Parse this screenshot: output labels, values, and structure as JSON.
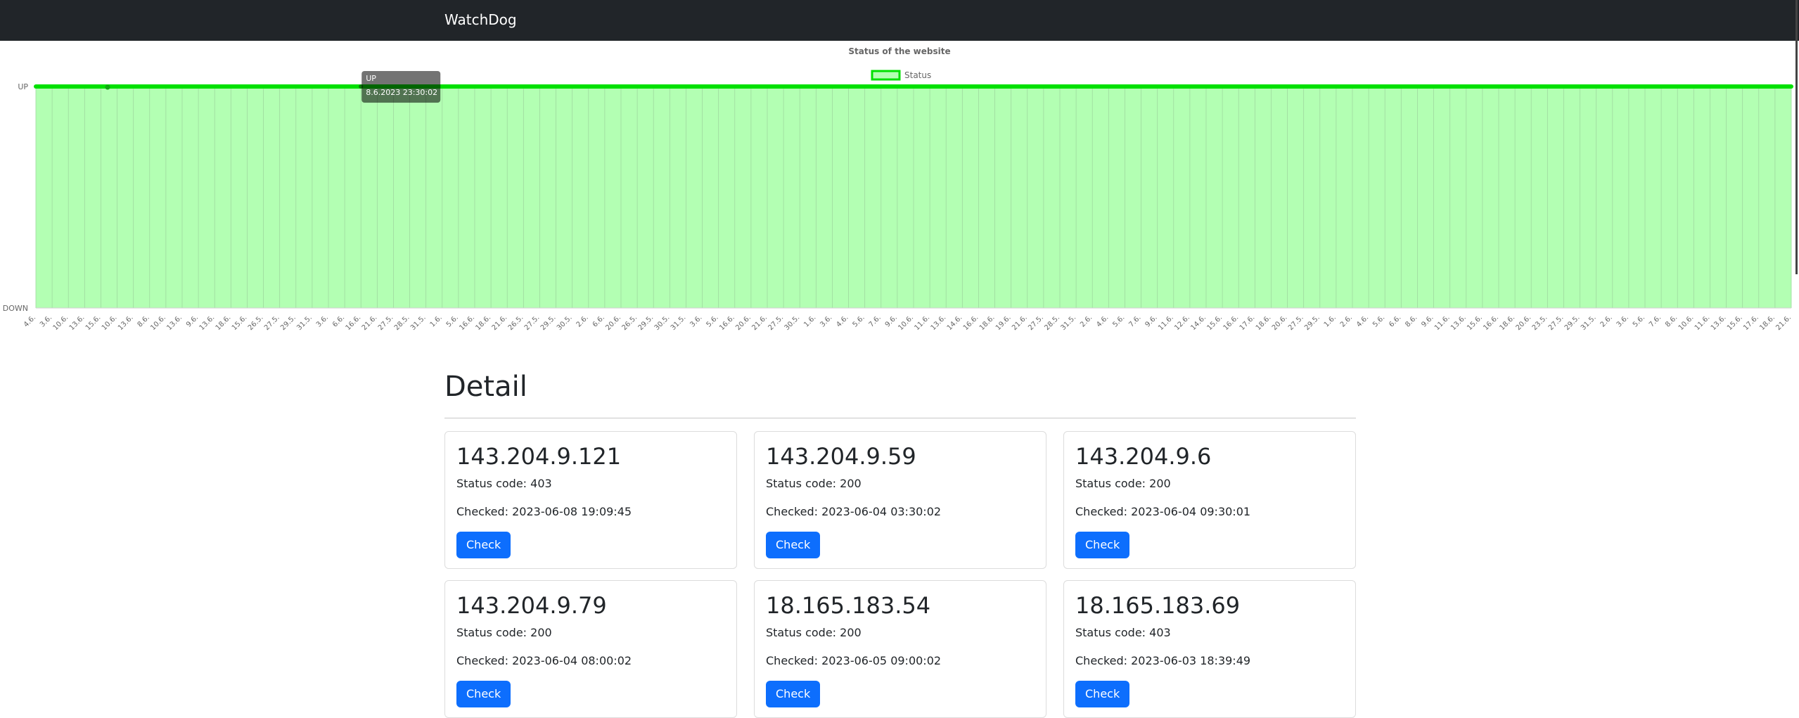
{
  "navbar": {
    "brand": "WatchDog"
  },
  "chart_data": {
    "type": "area",
    "title": "Status of the website",
    "legend": {
      "label": "Status",
      "position": "top-center"
    },
    "y_categories": [
      "DOWN",
      "UP"
    ],
    "x": [
      "4.6.",
      "3.6.",
      "10.6.",
      "13.6.",
      "15.6.",
      "10.6.",
      "13.6.",
      "8.6.",
      "10.6.",
      "13.6.",
      "9.6.",
      "13.6.",
      "18.6.",
      "15.6.",
      "26.5.",
      "27.5.",
      "29.5.",
      "31.5.",
      "3.6.",
      "6.6.",
      "16.6.",
      "21.6.",
      "27.5.",
      "28.5.",
      "31.5.",
      "1.6.",
      "5.6.",
      "16.6.",
      "18.6.",
      "21.6.",
      "26.5.",
      "27.5.",
      "29.5.",
      "30.5.",
      "2.6.",
      "6.6.",
      "20.6.",
      "26.5.",
      "29.5.",
      "30.5.",
      "31.5.",
      "3.6.",
      "5.6.",
      "16.6.",
      "20.6.",
      "21.6.",
      "27.5.",
      "30.5.",
      "1.6.",
      "3.6.",
      "4.6.",
      "5.6.",
      "7.6.",
      "9.6.",
      "10.6.",
      "11.6.",
      "13.6.",
      "14.6.",
      "16.6.",
      "18.6.",
      "19.6.",
      "21.6.",
      "27.5.",
      "28.5.",
      "31.5.",
      "2.6.",
      "4.6.",
      "5.6.",
      "7.6.",
      "9.6.",
      "11.6.",
      "12.6.",
      "14.6.",
      "15.6.",
      "16.6.",
      "17.6.",
      "18.6.",
      "20.6.",
      "27.5.",
      "29.5.",
      "1.6.",
      "2.6.",
      "4.6.",
      "5.6.",
      "6.6.",
      "8.6.",
      "9.6.",
      "11.6.",
      "13.6.",
      "15.6.",
      "16.6.",
      "18.6.",
      "20.6.",
      "23.5.",
      "27.5.",
      "29.5.",
      "31.5.",
      "2.6.",
      "3.6.",
      "5.6.",
      "7.6.",
      "8.6.",
      "10.6.",
      "11.6.",
      "13.6.",
      "15.6.",
      "17.6.",
      "18.6.",
      "21.6."
    ],
    "values": "all UP",
    "status_level": 1,
    "tooltip": {
      "title": "UP",
      "body": "8.6.2023 23:30:02",
      "point_index": 20
    },
    "colors": {
      "line": "#00e000",
      "fill": "#b3ffb3",
      "grid": "#9fd89f"
    }
  },
  "detail": {
    "title": "Detail",
    "cards": [
      {
        "ip": "143.204.9.121",
        "status": "Status code: 403",
        "checked": "Checked: 2023-06-08 19:09:45",
        "button": "Check"
      },
      {
        "ip": "143.204.9.59",
        "status": "Status code: 200",
        "checked": "Checked: 2023-06-04 03:30:02",
        "button": "Check"
      },
      {
        "ip": "143.204.9.6",
        "status": "Status code: 200",
        "checked": "Checked: 2023-06-04 09:30:01",
        "button": "Check"
      },
      {
        "ip": "143.204.9.79",
        "status": "Status code: 200",
        "checked": "Checked: 2023-06-04 08:00:02",
        "button": "Check"
      },
      {
        "ip": "18.165.183.54",
        "status": "Status code: 200",
        "checked": "Checked: 2023-06-05 09:00:02",
        "button": "Check"
      },
      {
        "ip": "18.165.183.69",
        "status": "Status code: 403",
        "checked": "Checked: 2023-06-03 18:39:49",
        "button": "Check"
      }
    ]
  }
}
